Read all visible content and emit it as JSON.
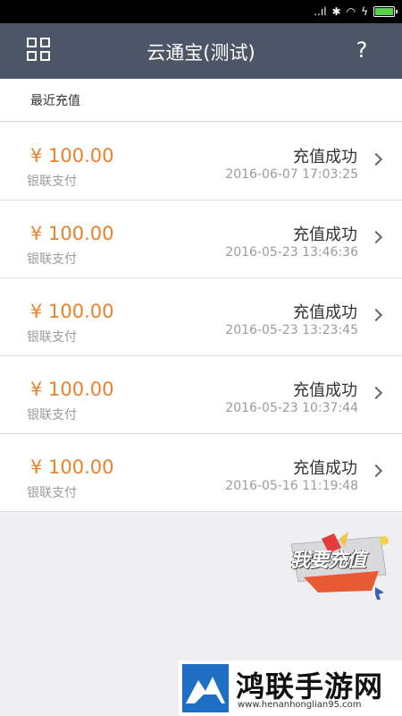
{
  "status_bar": {
    "signal": "..ıl",
    "bluetooth_icon": "bluetooth-icon",
    "wifi_icon": "wifi-icon",
    "battery_level": 1.0,
    "battery_color": "#58d04d"
  },
  "header": {
    "title": "云通宝(测试)",
    "help_label": "?",
    "background": "#4d5666"
  },
  "section": {
    "title": "最近充值"
  },
  "records": [
    {
      "amount": "¥ 100.00",
      "method": "银联支付",
      "status": "充值成功",
      "time": "2016-06-07 17:03:25"
    },
    {
      "amount": "¥ 100.00",
      "method": "银联支付",
      "status": "充值成功",
      "time": "2016-05-23 13:46:36"
    },
    {
      "amount": "¥ 100.00",
      "method": "银联支付",
      "status": "充值成功",
      "time": "2016-05-23 13:23:45"
    },
    {
      "amount": "¥ 100.00",
      "method": "银联支付",
      "status": "充值成功",
      "time": "2016-05-23 10:37:44"
    },
    {
      "amount": "¥ 100.00",
      "method": "银联支付",
      "status": "充值成功",
      "time": "2016-05-16 11:19:48"
    }
  ],
  "fab": {
    "label": "我要充值"
  },
  "watermark": {
    "name": "鸿联手游网",
    "url": "www.henanhonglian95.com"
  },
  "colors": {
    "amount": "#e8822c",
    "muted": "#9b9b9b"
  }
}
